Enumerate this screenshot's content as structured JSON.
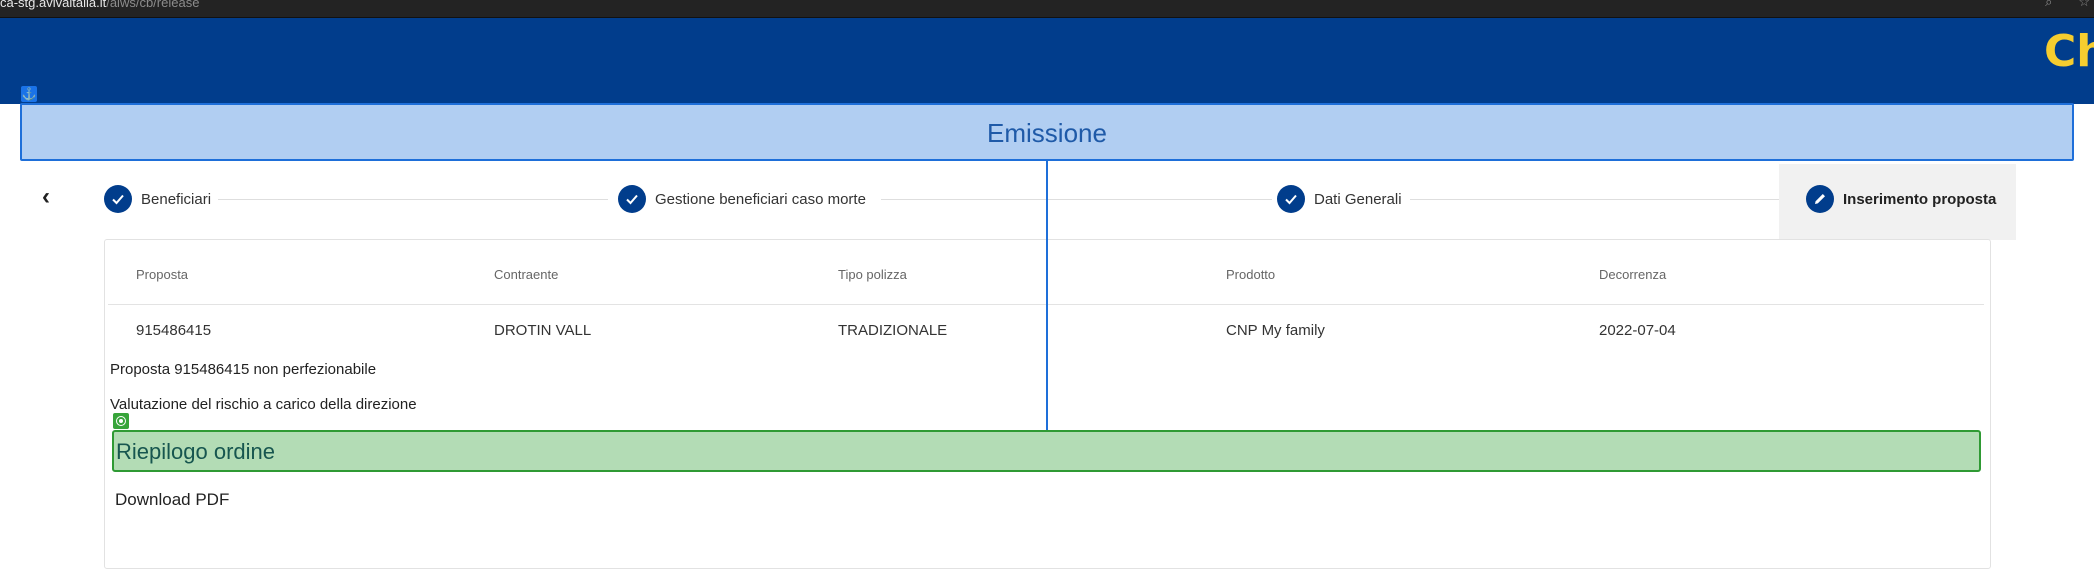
{
  "browser": {
    "url_host": "ca-stg.avivaitalia.it",
    "url_path": "/aiws/cb/release"
  },
  "header": {
    "brand_text": "Ch",
    "background_color": "#013d8c",
    "brand_color": "#f6cd2f"
  },
  "section": {
    "title": "Emissione"
  },
  "stepper": {
    "steps": [
      {
        "label": "Beneficiari",
        "state": "completed",
        "icon": "check-icon"
      },
      {
        "label": "Gestione beneficiari caso morte",
        "state": "completed",
        "icon": "check-icon"
      },
      {
        "label": "Dati Generali",
        "state": "completed",
        "icon": "check-icon"
      },
      {
        "label": "Inserimento proposta",
        "state": "active",
        "icon": "pencil-icon"
      }
    ]
  },
  "table": {
    "headers": [
      "Proposta",
      "Contraente",
      "Tipo polizza",
      "Prodotto",
      "Decorrenza"
    ],
    "row": [
      "915486415",
      "DROTIN VALL",
      "TRADIZIONALE",
      "CNP My family",
      "2022-07-04"
    ]
  },
  "messages": {
    "not_finalizable": "Proposta 915486415 non perfezionabile",
    "risk_assessment": "Valutazione del rischio a carico della direzione"
  },
  "summary": {
    "title": "Riepilogo ordine",
    "download_label": "Download PDF"
  }
}
